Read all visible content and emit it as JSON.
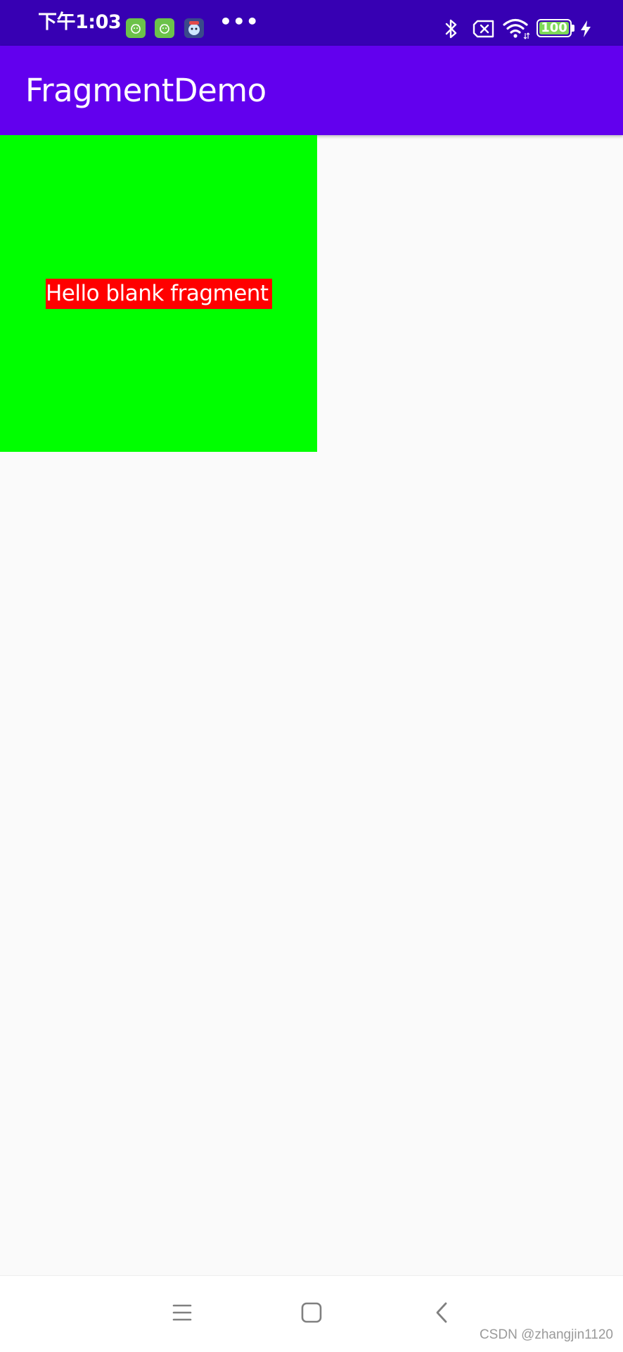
{
  "status_bar": {
    "time": "下午1:03",
    "more": "•••",
    "battery": "100",
    "icons": [
      "android-notification-icon",
      "android-notification-icon",
      "app-notification-icon",
      "bluetooth-icon",
      "no-sim-icon",
      "wifi-icon",
      "battery-icon",
      "charging-icon"
    ],
    "background_color": "#3700b3"
  },
  "app_bar": {
    "title": "FragmentDemo",
    "background_color": "#6200ee"
  },
  "fragment": {
    "text": "Hello blank fragment",
    "background_color": "#00ff00",
    "text_background_color": "#ff0000"
  },
  "nav_bar": {
    "buttons": [
      "menu-icon",
      "home-icon",
      "back-icon"
    ]
  },
  "watermark": "CSDN @zhangjin1120"
}
